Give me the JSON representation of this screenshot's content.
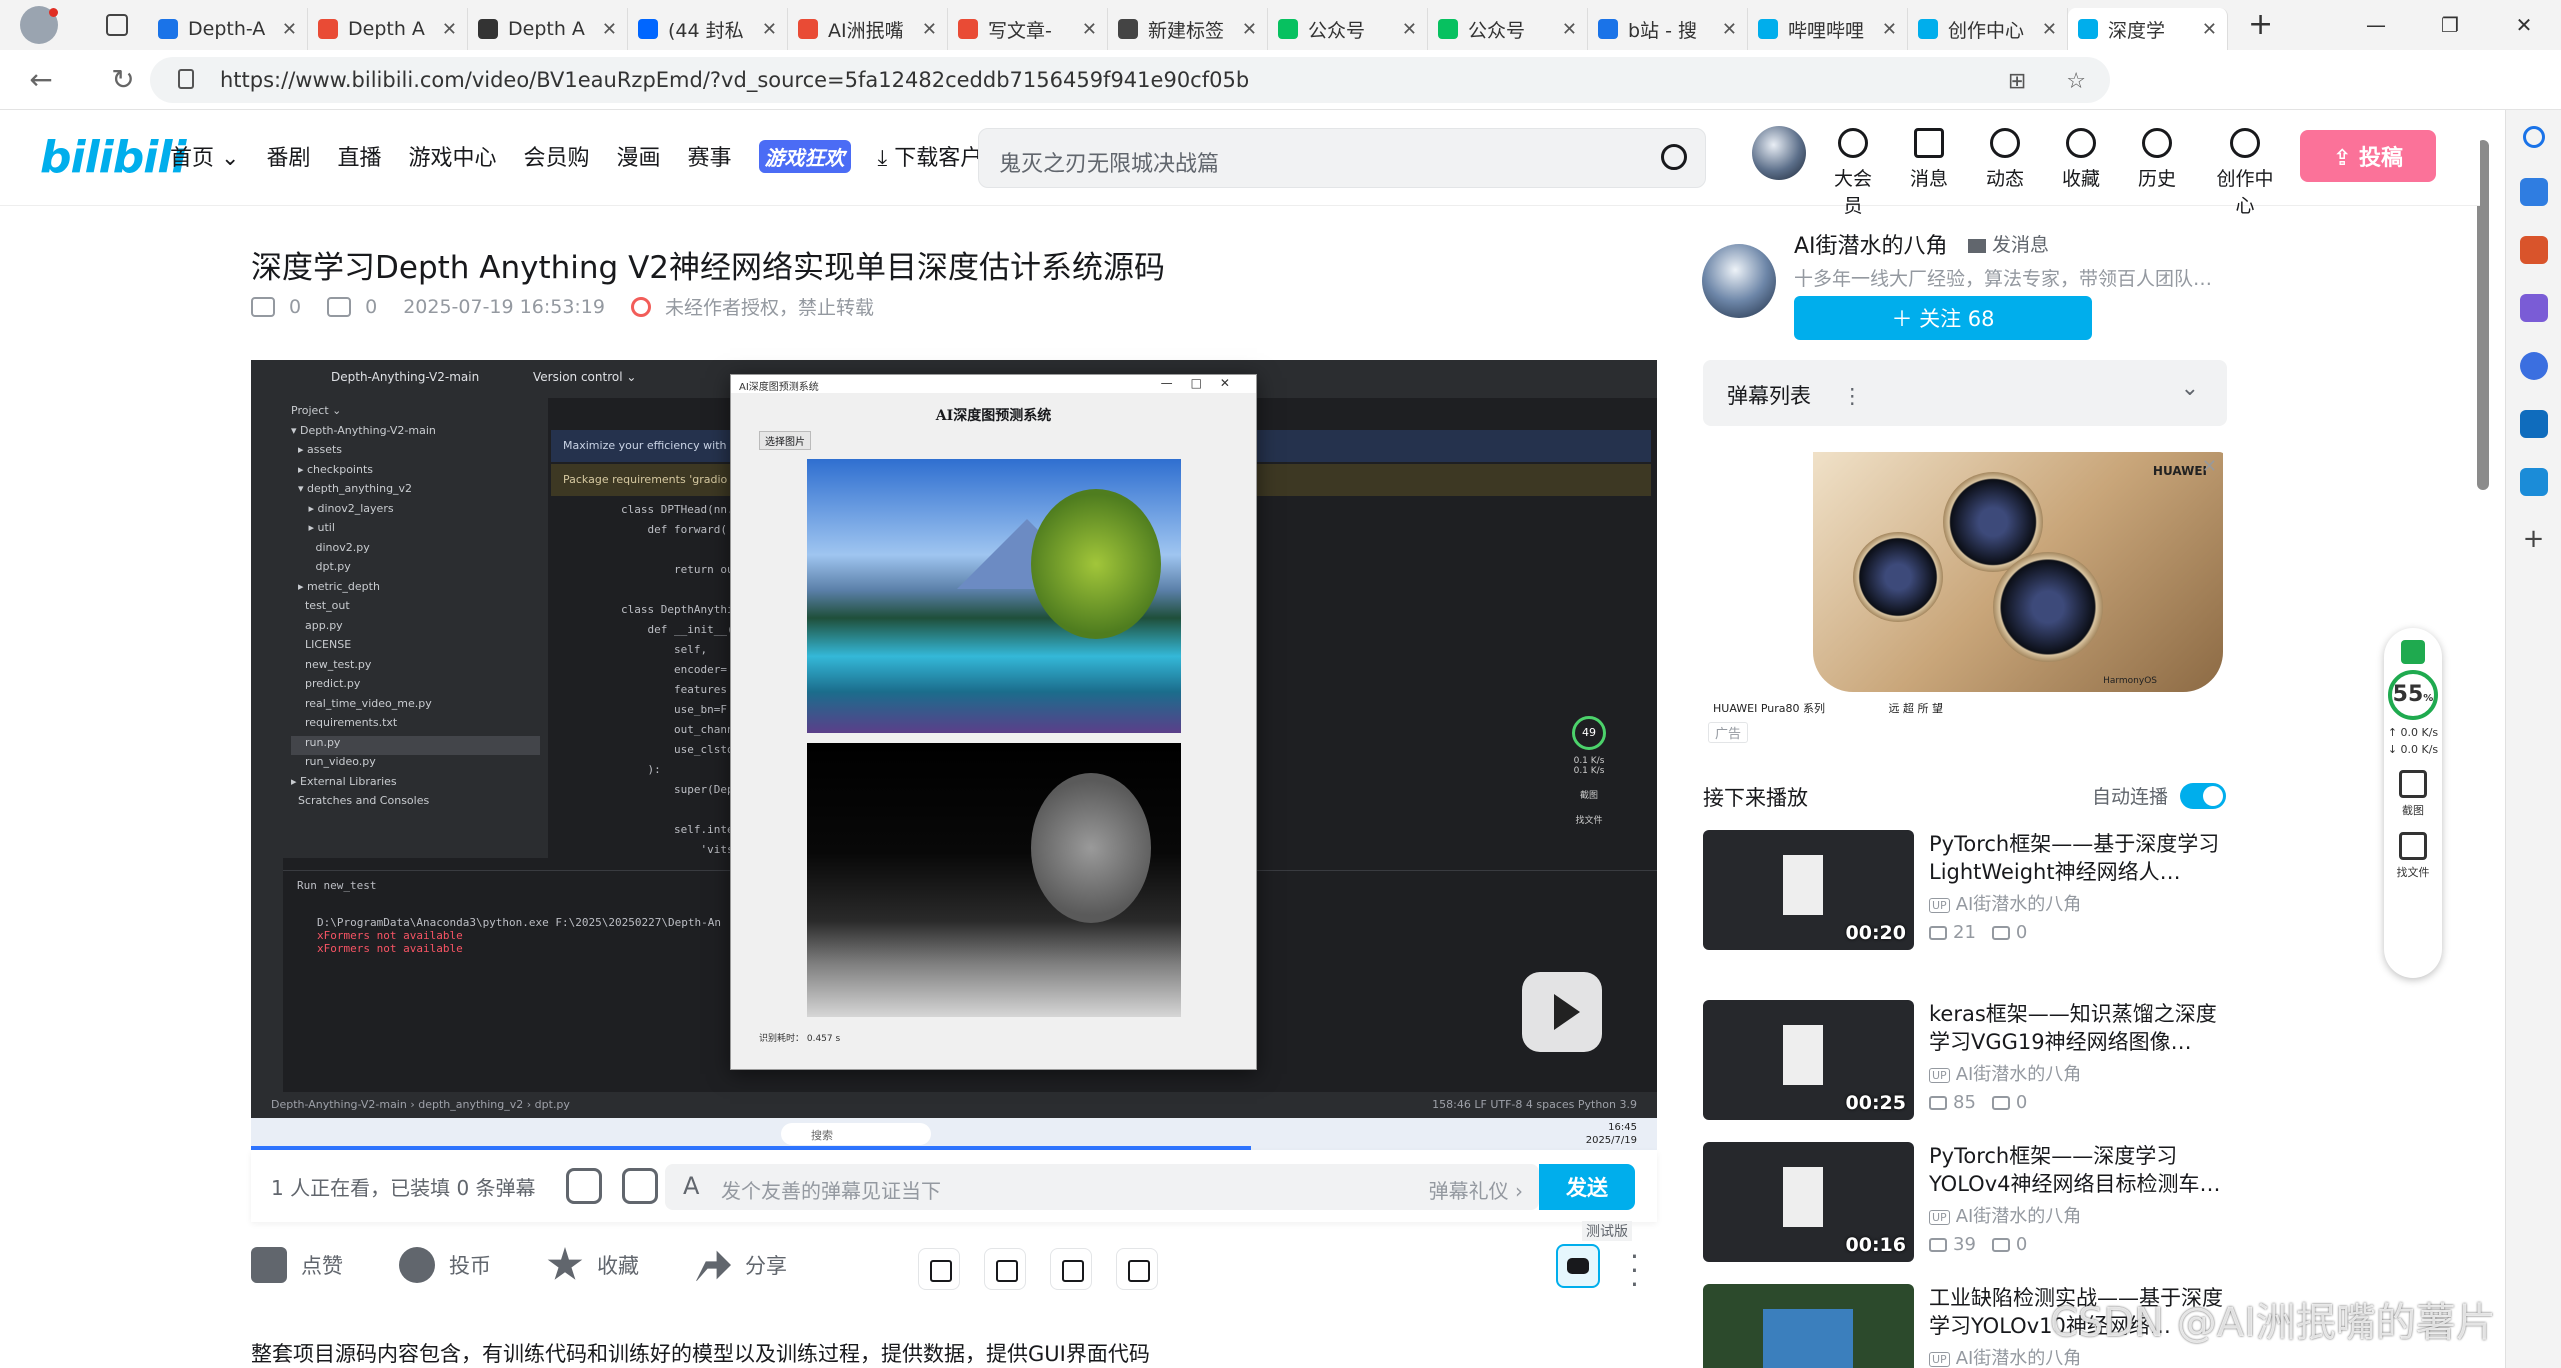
{
  "browser": {
    "tabs": [
      {
        "title": "Depth-A",
        "color": "#1a73e8"
      },
      {
        "title": "Depth A",
        "color": "#e94b35"
      },
      {
        "title": "Depth A",
        "color": "#333333"
      },
      {
        "title": "(44 封私",
        "color": "#0066ff"
      },
      {
        "title": "AI洲抿嘴",
        "color": "#e94b35"
      },
      {
        "title": "写文章-",
        "color": "#e94b35"
      },
      {
        "title": "新建标签",
        "color": "#444444"
      },
      {
        "title": "公众号",
        "color": "#07c160"
      },
      {
        "title": "公众号",
        "color": "#07c160"
      },
      {
        "title": "b站 - 搜",
        "color": "#1a73e8"
      },
      {
        "title": "哔哩哔哩",
        "color": "#00aeec"
      },
      {
        "title": "创作中心",
        "color": "#00aeec"
      },
      {
        "title": "深度学",
        "color": "#00aeec"
      }
    ],
    "url": "https://www.bilibili.com/video/BV1eauRzpEmd/?vd_source=5fa12482ceddb7156459f941e90cf05b"
  },
  "header": {
    "logo": "bilibili",
    "nav": [
      "首页 ⌄",
      "番剧",
      "直播",
      "游戏中心",
      "会员购",
      "漫画",
      "赛事"
    ],
    "game_logo": "游戏狂欢",
    "download": "⤓ 下载客户端",
    "search_placeholder": "鬼灭之刃无限城决战篇",
    "icons": [
      "大会员",
      "消息",
      "动态",
      "收藏",
      "历史",
      "创作中心"
    ],
    "upload": "⇪ 投稿"
  },
  "video": {
    "title": "深度学习Depth Anything V2神经网络实现单目深度估计系统源码",
    "plays": "0",
    "danmaku_count": "0",
    "date": "2025-07-19 16:53:19",
    "copyright": "未经作者授权，禁止转载"
  },
  "ide": {
    "project": "Depth-Anything-V2-main",
    "version_control": "Version control ⌄",
    "tree": [
      "Project ⌄",
      "▾ Depth-Anything-V2-main",
      "  ▸ assets",
      "  ▸ checkpoints",
      "  ▾ depth_anything_v2",
      "     ▸ dinov2_layers",
      "     ▸ util",
      "       dinov2.py",
      "       dpt.py",
      "  ▸ metric_depth",
      "    test_out",
      "    app.py",
      "    LICENSE",
      "    new_test.py",
      "    predict.py",
      "    real_time_video_me.py",
      "    requirements.txt",
      "    run.py",
      "    run_video.py",
      "▸ External Libraries",
      "  Scratches and Consoles"
    ],
    "banner1": "Maximize your efficiency with",
    "banner2": "Package requirements 'gradio",
    "code": [
      "class DPTHead(nn.",
      "    def forward(",
      "",
      "        return ou",
      "",
      "class DepthAnythi",
      "    def __init__(",
      "        self,",
      "        encoder=",
      "        features",
      "        use_bn=F",
      "        out_chann",
      "        use_clsto",
      "    ):",
      "        super(Dep",
      "",
      "        self.inte",
      "            'vits"
    ],
    "run_tab": "Run   new_test",
    "run_lines": [
      "D:\\ProgramData\\Anaconda3\\python.exe F:\\2025\\20250227\\Depth-An",
      "xFormers not available",
      "xFormers not available"
    ],
    "status": "Depth-Anything-V2-main › depth_anything_v2 › dpt.py",
    "status_right": "158:46   LF   UTF-8   4 spaces   Python 3.9",
    "taskbar_search": "搜索",
    "clock_time": "16:45",
    "clock_date": "2025/7/19"
  },
  "app": {
    "window_title": "AI深度图预测系统",
    "heading": "AI深度图预测系统",
    "pick_button": "选择图片",
    "elapsed": "识别耗时： 0.457 s"
  },
  "overlay": {
    "percent": "49",
    "rate1": "0.1 K/s",
    "rate2": "0.1 K/s",
    "screenshot": "截图",
    "find": "找文件"
  },
  "danmaku": {
    "status": "1 人正在看，已装填 0 条弹幕",
    "placeholder": "发个友善的弹幕见证当下",
    "etiquette": "弹幕礼仪 ›",
    "send": "发送"
  },
  "actions": {
    "like": "点赞",
    "coin": "投币",
    "favorite": "收藏",
    "share": "分享",
    "test_badge": "测试版"
  },
  "description": "整套项目源码内容包含，有训练代码和训练好的模型以及训练过程，提供数据，提供GUI界面代码",
  "uploader": {
    "name": "AI街潜水的八角",
    "message": "发消息",
    "desc": "十多年一线大厂经验，算法专家，带领百人团队…",
    "follow": "＋ 关注 68"
  },
  "danmaku_list": {
    "title": "弹幕列表",
    "more": "⋮",
    "chevron": "⌄"
  },
  "ad": {
    "brand": "HUAWEI",
    "model": "HUAWEI Pura80 系列",
    "slogan": "远  超  所  望",
    "os": "HarmonyOS",
    "tag": "广告"
  },
  "next": {
    "title": "接下来播放",
    "autoplay": "自动连播",
    "items": [
      {
        "title": "PyTorch框架——基于深度学习LightWeight神经网络人…",
        "up": "AI街潜水的八角",
        "plays": "21",
        "dm": "0",
        "duration": "00:20"
      },
      {
        "title": "keras框架——知识蒸馏之深度学习VGG19神经网络图像…",
        "up": "AI街潜水的八角",
        "plays": "85",
        "dm": "0",
        "duration": "00:25"
      },
      {
        "title": "PyTorch框架——深度学习YOLOv4神经网络目标检测车…",
        "up": "AI街潜水的八角",
        "plays": "39",
        "dm": "0",
        "duration": "00:16"
      },
      {
        "title": "工业缺陷检测实战——基于深度学习YOLOv10神经网络…",
        "up": "AI街潜水的八角",
        "plays": "",
        "dm": "",
        "duration": ""
      }
    ]
  },
  "speed_widget": {
    "percent": "55",
    "unit": "%",
    "up": "↑ 0.0 K/s",
    "down": "↓ 0.0 K/s",
    "screenshot": "截图",
    "find": "找文件"
  },
  "watermark": "CSDN @AI洲抿嘴的薯片"
}
